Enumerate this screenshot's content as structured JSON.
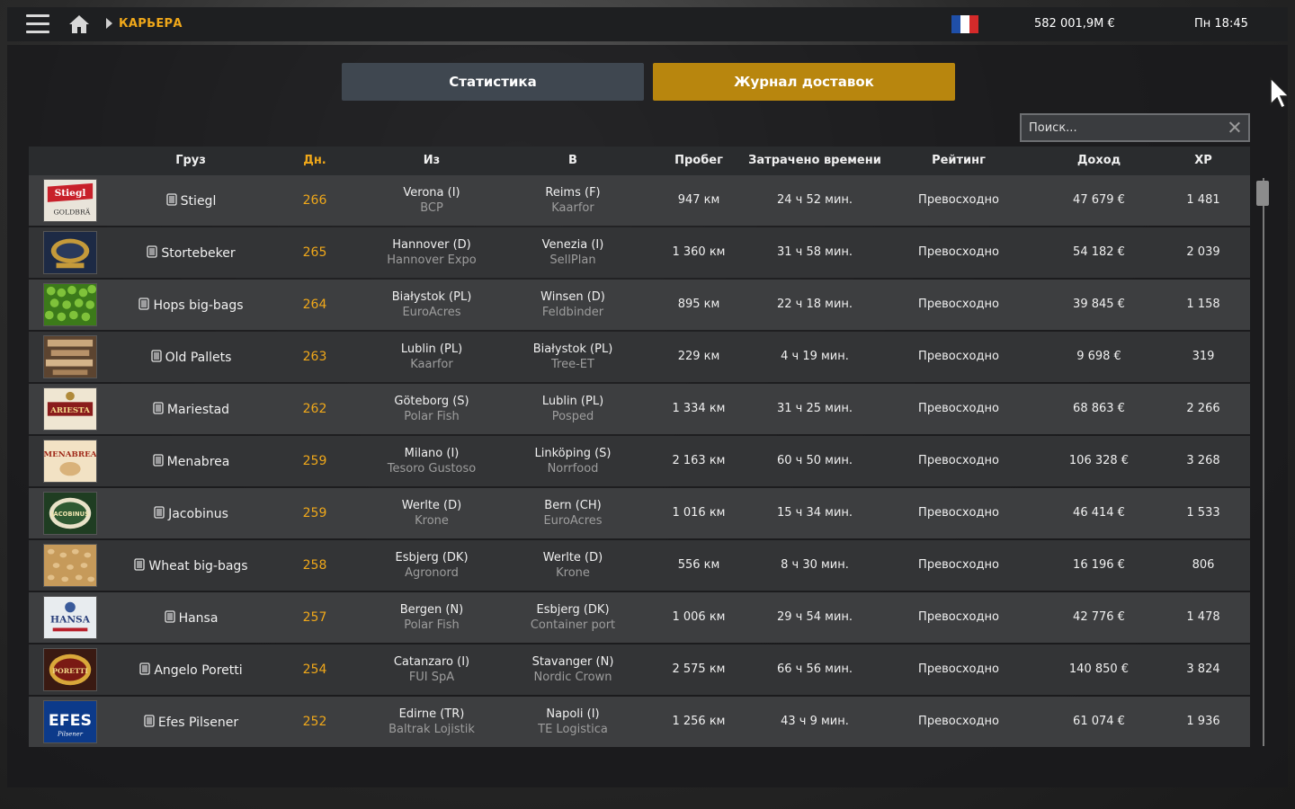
{
  "header": {
    "breadcrumb": "КАРЬЕРА",
    "money": "582 001,9M  €",
    "clock": "Пн 18:45",
    "flag_colors": [
      "#1f4fa8",
      "#ffffff",
      "#d42a2a"
    ]
  },
  "tabs": [
    {
      "label": "Статистика",
      "active": false
    },
    {
      "label": "Журнал доставок",
      "active": true
    }
  ],
  "search": {
    "placeholder": "Поиск..."
  },
  "columns": {
    "cargo": "Груз",
    "days": "Дн.",
    "from": "Из",
    "to": "В",
    "distance": "Пробег",
    "time": "Затрачено времени",
    "rating": "Рейтинг",
    "income": "Доход",
    "xp": "XP"
  },
  "colors": {
    "accent": "#f0a81a",
    "active_tab": "#b8860e",
    "inactive_tab": "#3f4750"
  },
  "rows": [
    {
      "cargo": "Stiegl",
      "day": "266",
      "from_city": "Verona (I)",
      "from_company": "BCP",
      "to_city": "Reims (F)",
      "to_company": "Kaarfor",
      "distance": "947 км",
      "time": "24 ч 52 мин.",
      "rating": "Превосходно",
      "income": "47 679 €",
      "xp": "1 481",
      "thumb_icon": "stiegl-label-icon"
    },
    {
      "cargo": "Stortebeker",
      "day": "265",
      "from_city": "Hannover (D)",
      "from_company": "Hannover Expo",
      "to_city": "Venezia (I)",
      "to_company": "SellPlan",
      "distance": "1 360 км",
      "time": "31 ч 58 мин.",
      "rating": "Превосходно",
      "income": "54 182 €",
      "xp": "2 039",
      "thumb_icon": "stortebeker-label-icon"
    },
    {
      "cargo": "Hops big-bags",
      "day": "264",
      "from_city": "Białystok (PL)",
      "from_company": "EuroAcres",
      "to_city": "Winsen (D)",
      "to_company": "Feldbinder",
      "distance": "895 км",
      "time": "22 ч 18 мин.",
      "rating": "Превосходно",
      "income": "39 845 €",
      "xp": "1 158",
      "thumb_icon": "hops-icon"
    },
    {
      "cargo": "Old Pallets",
      "day": "263",
      "from_city": "Lublin (PL)",
      "from_company": "Kaarfor",
      "to_city": "Białystok (PL)",
      "to_company": "Tree-ET",
      "distance": "229 км",
      "time": "4 ч 19 мин.",
      "rating": "Превосходно",
      "income": "9 698 €",
      "xp": "319",
      "thumb_icon": "pallets-icon"
    },
    {
      "cargo": "Mariestad",
      "day": "262",
      "from_city": "Göteborg (S)",
      "from_company": "Polar Fish",
      "to_city": "Lublin (PL)",
      "to_company": "Posped",
      "distance": "1 334 км",
      "time": "31 ч 25 мин.",
      "rating": "Превосходно",
      "income": "68 863 €",
      "xp": "2 266",
      "thumb_icon": "mariestad-label-icon"
    },
    {
      "cargo": "Menabrea",
      "day": "259",
      "from_city": "Milano (I)",
      "from_company": "Tesoro Gustoso",
      "to_city": "Linköping (S)",
      "to_company": "Norrfood",
      "distance": "2 163 км",
      "time": "60 ч 50 мин.",
      "rating": "Превосходно",
      "income": "106 328 €",
      "xp": "3 268",
      "thumb_icon": "menabrea-label-icon"
    },
    {
      "cargo": "Jacobinus",
      "day": "259",
      "from_city": "Werlte (D)",
      "from_company": "Krone",
      "to_city": "Bern (CH)",
      "to_company": "EuroAcres",
      "distance": "1 016 км",
      "time": "15 ч 34 мин.",
      "rating": "Превосходно",
      "income": "46 414 €",
      "xp": "1 533",
      "thumb_icon": "jacobinus-label-icon"
    },
    {
      "cargo": "Wheat big-bags",
      "day": "258",
      "from_city": "Esbjerg (DK)",
      "from_company": "Agronord",
      "to_city": "Werlte (D)",
      "to_company": "Krone",
      "distance": "556 км",
      "time": "8 ч 30 мин.",
      "rating": "Превосходно",
      "income": "16 196 €",
      "xp": "806",
      "thumb_icon": "wheat-icon"
    },
    {
      "cargo": "Hansa",
      "day": "257",
      "from_city": "Bergen (N)",
      "from_company": "Polar Fish",
      "to_city": "Esbjerg (DK)",
      "to_company": "Container port",
      "distance": "1 006 км",
      "time": "29 ч 54 мин.",
      "rating": "Превосходно",
      "income": "42 776 €",
      "xp": "1 478",
      "thumb_icon": "hansa-label-icon"
    },
    {
      "cargo": "Angelo Poretti",
      "day": "254",
      "from_city": "Catanzaro (I)",
      "from_company": "FUI SpA",
      "to_city": "Stavanger (N)",
      "to_company": "Nordic Crown",
      "distance": "2 575 км",
      "time": "66 ч 56 мин.",
      "rating": "Превосходно",
      "income": "140 850 €",
      "xp": "3 824",
      "thumb_icon": "poretti-label-icon"
    },
    {
      "cargo": "Efes Pilsener",
      "day": "252",
      "from_city": "Edirne (TR)",
      "from_company": "Baltrak Lojistik",
      "to_city": "Napoli (I)",
      "to_company": "TE Logistica",
      "distance": "1 256 км",
      "time": "43 ч 9 мин.",
      "rating": "Превосходно",
      "income": "61 074 €",
      "xp": "1 936",
      "thumb_icon": "efes-label-icon"
    }
  ]
}
